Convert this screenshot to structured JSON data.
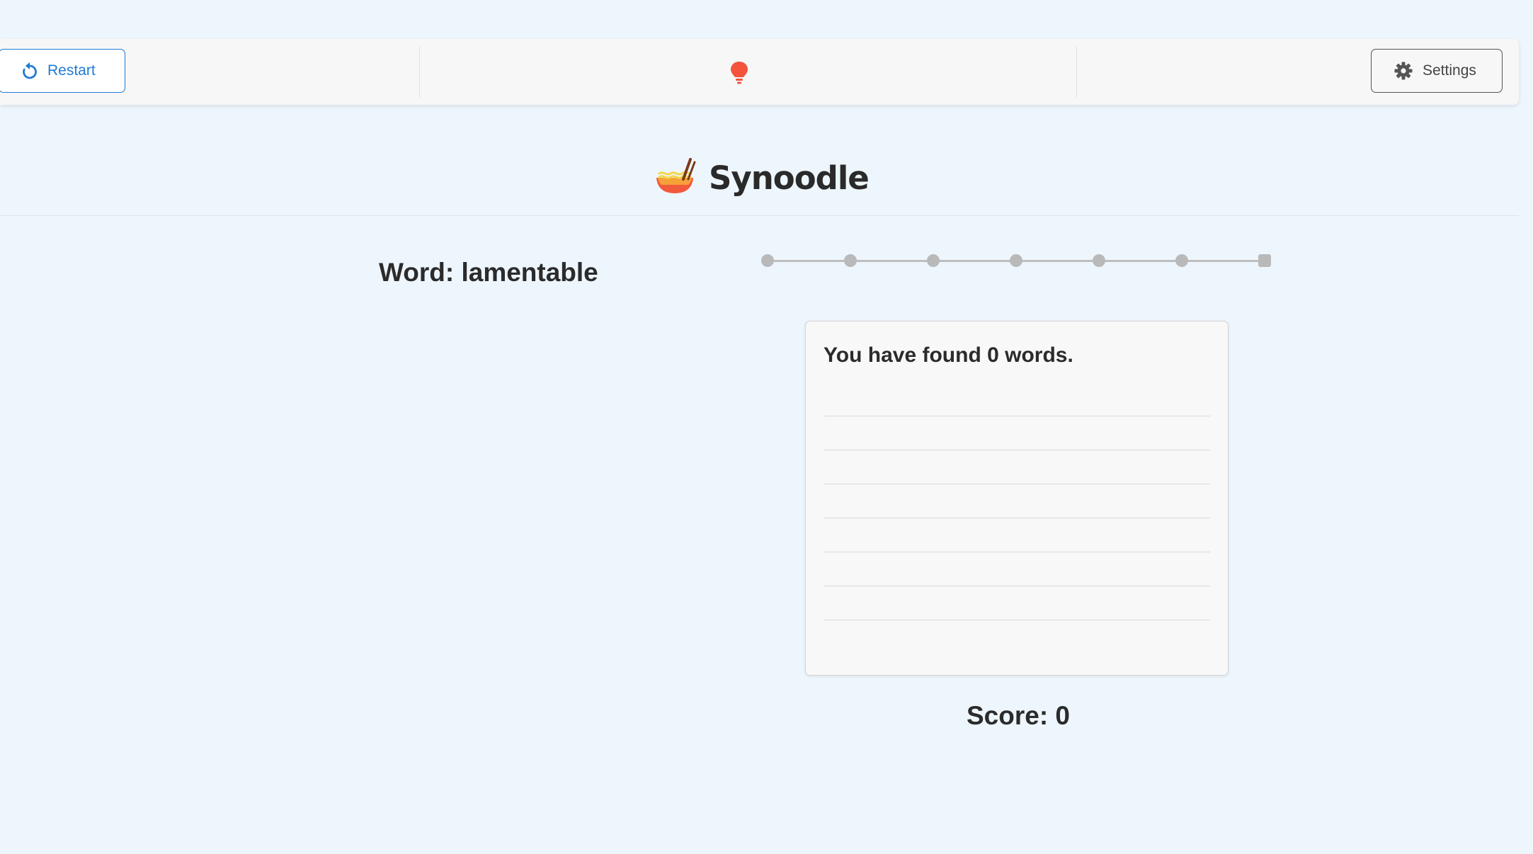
{
  "toolbar": {
    "restart_label": "Restart",
    "settings_label": "Settings",
    "restart_icon": "restart-icon",
    "hint_icon": "lightbulb-icon",
    "settings_icon": "gear-icon",
    "accent_color": "#1e7bd6",
    "hint_color": "#f4533c"
  },
  "logo": {
    "text": "Synoodle",
    "icon": "noodle-bowl-icon"
  },
  "game": {
    "word_label": "Word: lamentable",
    "progress_steps": 7,
    "progress_current": 0,
    "found_text": "You have found 0 words.",
    "found_words": [],
    "score_text": "Score: 0"
  }
}
